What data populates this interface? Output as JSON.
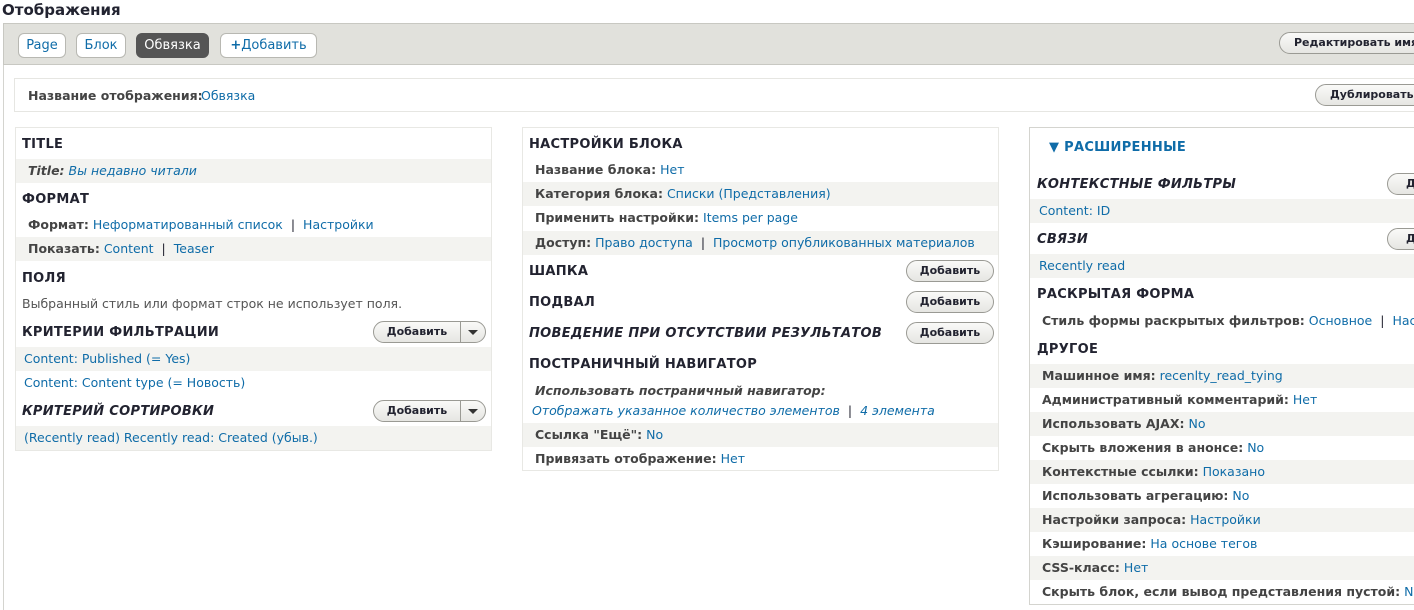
{
  "page_title": "Отображения",
  "tabs": [
    {
      "label": "Page"
    },
    {
      "label": "Блок"
    },
    {
      "label": "Обвязка"
    },
    {
      "label": "Добавить",
      "icon": "plus-icon"
    }
  ],
  "edit_name_button": "Редактировать имя/о",
  "display_name": {
    "label": "Название отображения:",
    "value": "Обвязка"
  },
  "duplicate_button": "Дублировать О",
  "left": {
    "title": {
      "heading": "TITLE",
      "label": "Title:",
      "value": "Вы недавно читали"
    },
    "format": {
      "heading": "ФОРМАТ",
      "format_label": "Формат:",
      "format_value": "Неформатированный список",
      "format_settings": "Настройки",
      "show_label": "Показать:",
      "show_value": "Content",
      "show_settings": "Teaser"
    },
    "fields": {
      "heading": "ПОЛЯ",
      "note": "Выбранный стиль или формат строк не использует поля."
    },
    "filters": {
      "heading": "КРИТЕРИИ ФИЛЬТРАЦИИ",
      "add": "Добавить",
      "items": [
        "Content: Published (= Yes)",
        "Content: Content type (= Новость)"
      ]
    },
    "sort": {
      "heading": "КРИТЕРИЙ СОРТИРОВКИ",
      "add": "Добавить",
      "items": [
        "(Recently read) Recently read: Created (убыв.)"
      ]
    }
  },
  "middle": {
    "block_settings": {
      "heading": "НАСТРОЙКИ БЛОКА",
      "block_name_label": "Название блока:",
      "block_name_value": "Нет",
      "block_category_label": "Категория блока:",
      "block_category_value": "Списки (Представления)",
      "apply_label": "Применить настройки:",
      "apply_value": "Items per page",
      "access_label": "Доступ:",
      "access_value": "Право доступа",
      "access_value2": "Просмотр опубликованных материалов"
    },
    "header": {
      "heading": "ШАПКА",
      "add": "Добавить"
    },
    "footer": {
      "heading": "ПОДВАЛ",
      "add": "Добавить"
    },
    "no_results": {
      "heading": "ПОВЕДЕНИЕ ПРИ ОТСУТСТВИИ РЕЗУЛЬТАТОВ",
      "add": "Добавить"
    },
    "pager": {
      "heading": "ПОСТРАНИЧНЫЙ НАВИГАТОР",
      "use_label": "Использовать постраничный навигатор:",
      "use_value": "Отображать указанное количество элементов",
      "use_value2": "4 элемента",
      "more_label": "Ссылка \"Ещё\":",
      "more_value": "No",
      "attach_label": "Привязать отображение:",
      "attach_value": "Нет"
    }
  },
  "right": {
    "advanced_title": "РАСШИРЕННЫЕ",
    "contextual": {
      "heading": "КОНТЕКСТНЫЕ ФИЛЬТРЫ",
      "add": "Доб",
      "items": [
        "Content: ID"
      ]
    },
    "relationships": {
      "heading": "СВЯЗИ",
      "add": "Доб",
      "items": [
        "Recently read"
      ]
    },
    "exposed": {
      "heading": "РАСКРЫТАЯ ФОРМА",
      "style_label": "Стиль формы раскрытых фильтров:",
      "style_value": "Основное",
      "style_settings": "Наст"
    },
    "other": {
      "heading": "ДРУГОЕ",
      "rows": [
        {
          "label": "Машинное имя:",
          "value": "recenlty_read_tying"
        },
        {
          "label": "Административный комментарий:",
          "value": "Нет"
        },
        {
          "label": "Использовать AJAX:",
          "value": "No"
        },
        {
          "label": "Скрыть вложения в анонсе:",
          "value": "No"
        },
        {
          "label": "Контекстные ссылки:",
          "value": "Показано"
        },
        {
          "label": "Использовать агрегацию:",
          "value": "No"
        },
        {
          "label": "Настройки запроса:",
          "value": "Настройки"
        },
        {
          "label": "Кэширование:",
          "value": "На основе тегов"
        },
        {
          "label": "CSS-класс:",
          "value": "Нет"
        },
        {
          "label": "Скрыть блок, если вывод представления пустой:",
          "value": "No"
        }
      ]
    }
  },
  "colors": {
    "link": "#0f6ca8",
    "active_tab": "#555555",
    "bar": "#e1e1dc"
  }
}
